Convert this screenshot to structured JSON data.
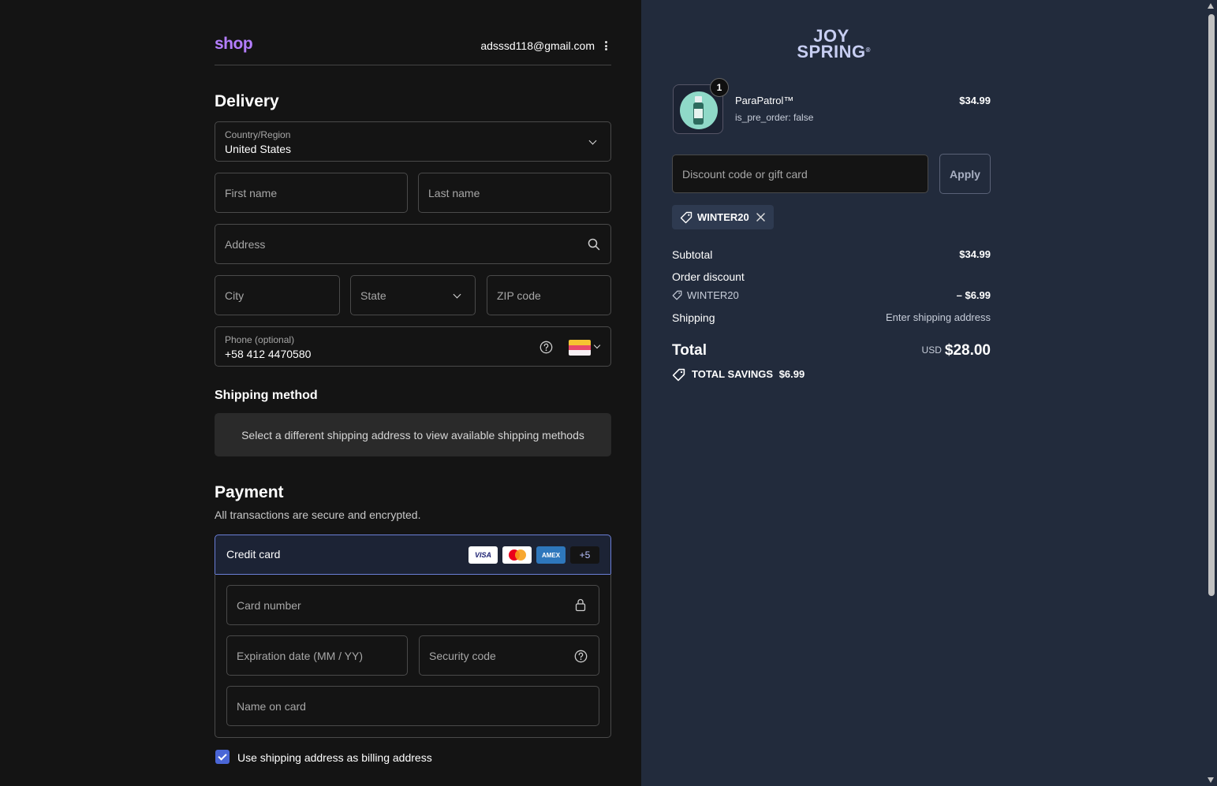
{
  "header": {
    "logo": "shop",
    "email": "adsssd118@gmail.com"
  },
  "delivery": {
    "title": "Delivery",
    "country_label": "Country/Region",
    "country_value": "United States",
    "first_name_placeholder": "First name",
    "last_name_placeholder": "Last name",
    "address_placeholder": "Address",
    "city_placeholder": "City",
    "state_placeholder": "State",
    "zip_placeholder": "ZIP code",
    "phone_label": "Phone (optional)",
    "phone_value": "+58 412 4470580"
  },
  "shipping_method": {
    "title": "Shipping method",
    "message": "Select a different shipping address to view available shipping methods"
  },
  "payment": {
    "title": "Payment",
    "subtitle": "All transactions are secure and encrypted.",
    "method_label": "Credit card",
    "card_logos": [
      "VISA",
      "mastercard",
      "AMEX"
    ],
    "more_cards": "+5",
    "card_number_placeholder": "Card number",
    "expiration_placeholder": "Expiration date (MM / YY)",
    "security_placeholder": "Security code",
    "name_placeholder": "Name on card",
    "billing_checkbox_label": "Use shipping address as billing address",
    "billing_checked": true
  },
  "summary": {
    "brand_line1": "JOY",
    "brand_line2": "SPRING",
    "brand_mark": "®",
    "product_name": "ParaPatrol™",
    "product_meta": "is_pre_order: false",
    "product_price": "$34.99",
    "product_qty": "1",
    "discount_placeholder": "Discount code or gift card",
    "apply_label": "Apply",
    "applied_code": "WINTER20",
    "subtotal_label": "Subtotal",
    "subtotal_value": "$34.99",
    "order_discount_label": "Order discount",
    "order_discount_code": "WINTER20",
    "order_discount_value": "– $6.99",
    "shipping_label": "Shipping",
    "shipping_value": "Enter shipping address",
    "total_label": "Total",
    "total_currency": "USD",
    "total_value": "$28.00",
    "savings_label": "TOTAL SAVINGS",
    "savings_value": "$6.99"
  },
  "colors": {
    "left_bg": "#141414",
    "right_bg": "#222b3c",
    "shop_purple": "#b47eff",
    "accent_blue": "#4a66d6"
  },
  "icons": [
    "kebab-menu-icon",
    "chevron-down-icon",
    "search-icon",
    "help-circle-icon",
    "flag-icon",
    "lock-icon",
    "tag-icon",
    "close-icon",
    "check-icon"
  ]
}
